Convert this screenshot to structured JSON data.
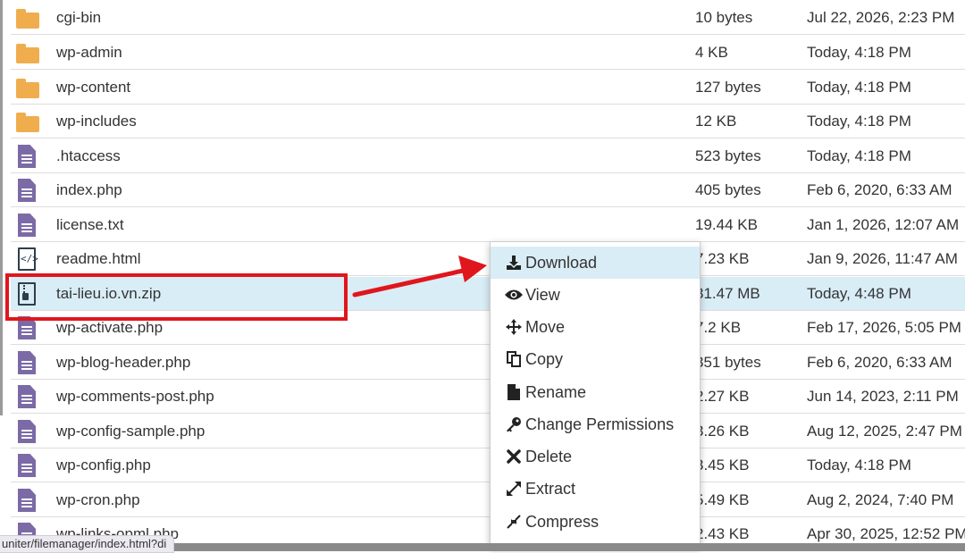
{
  "files": [
    {
      "name": "cgi-bin",
      "size": "10 bytes",
      "date": "Jul 22, 2026, 2:23 PM",
      "type": "folder"
    },
    {
      "name": "wp-admin",
      "size": "4 KB",
      "date": "Today, 4:18 PM",
      "type": "folder"
    },
    {
      "name": "wp-content",
      "size": "127 bytes",
      "date": "Today, 4:18 PM",
      "type": "folder"
    },
    {
      "name": "wp-includes",
      "size": "12 KB",
      "date": "Today, 4:18 PM",
      "type": "folder"
    },
    {
      "name": ".htaccess",
      "size": "523 bytes",
      "date": "Today, 4:18 PM",
      "type": "file"
    },
    {
      "name": "index.php",
      "size": "405 bytes",
      "date": "Feb 6, 2020, 6:33 AM",
      "type": "file"
    },
    {
      "name": "license.txt",
      "size": "19.44 KB",
      "date": "Jan 1, 2026, 12:07 AM",
      "type": "file"
    },
    {
      "name": "readme.html",
      "size": "7.23 KB",
      "date": "Jan 9, 2026, 11:47 AM",
      "type": "code"
    },
    {
      "name": "tai-lieu.io.vn.zip",
      "size": "31.47 MB",
      "date": "Today, 4:48 PM",
      "type": "zip"
    },
    {
      "name": "wp-activate.php",
      "size": "7.2 KB",
      "date": "Feb 17, 2026, 5:05 PM",
      "type": "file"
    },
    {
      "name": "wp-blog-header.php",
      "size": "351 bytes",
      "date": "Feb 6, 2020, 6:33 AM",
      "type": "file"
    },
    {
      "name": "wp-comments-post.php",
      "size": "2.27 KB",
      "date": "Jun 14, 2023, 2:11 PM",
      "type": "file"
    },
    {
      "name": "wp-config-sample.php",
      "size": "3.26 KB",
      "date": "Aug 12, 2025, 2:47 PM",
      "type": "file"
    },
    {
      "name": "wp-config.php",
      "size": "3.45 KB",
      "date": "Today, 4:18 PM",
      "type": "file"
    },
    {
      "name": "wp-cron.php",
      "size": "5.49 KB",
      "date": "Aug 2, 2024, 7:40 PM",
      "type": "file"
    },
    {
      "name": "wp-links-opml.php",
      "size": "2.43 KB",
      "date": "Apr 30, 2025, 12:52 PM",
      "type": "file"
    }
  ],
  "context_menu": {
    "items": [
      {
        "label": "Download",
        "icon": "download-icon"
      },
      {
        "label": "View",
        "icon": "eye-icon"
      },
      {
        "label": "Move",
        "icon": "move-icon"
      },
      {
        "label": "Copy",
        "icon": "copy-icon"
      },
      {
        "label": "Rename",
        "icon": "file-icon"
      },
      {
        "label": "Change Permissions",
        "icon": "key-icon"
      },
      {
        "label": "Delete",
        "icon": "close-icon"
      },
      {
        "label": "Extract",
        "icon": "expand-icon"
      },
      {
        "label": "Compress",
        "icon": "compress-icon"
      }
    ]
  },
  "status_bar": {
    "url": "uniter/filemanager/index.html?di"
  },
  "colors": {
    "folder": "#f0ad4e",
    "file": "#7b6aa6",
    "selected_row": "#d9edf7",
    "annotation": "#e0161d"
  }
}
